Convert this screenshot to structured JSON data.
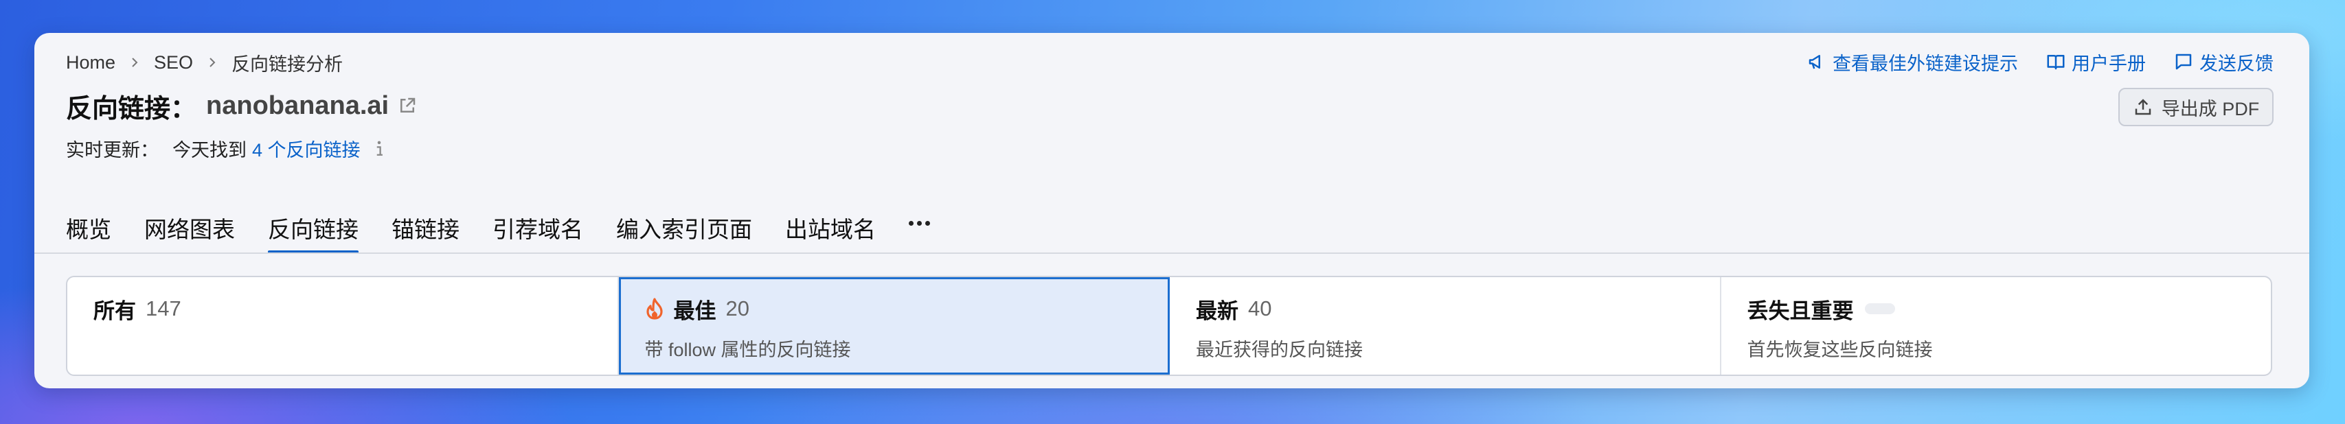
{
  "breadcrumb": {
    "home": "Home",
    "seo": "SEO",
    "current": "反向链接分析"
  },
  "title": {
    "prefix": "反向链接：",
    "domain": "nanobanana.ai"
  },
  "live": {
    "label": "实时更新：",
    "found_prefix": "今天找到",
    "link_text": "4 个反向链接"
  },
  "actions": {
    "tips": "查看最佳外链建设提示",
    "manual": "用户手册",
    "feedback": "发送反馈",
    "export": "导出成 PDF"
  },
  "tabs": [
    {
      "label": "概览"
    },
    {
      "label": "网络图表"
    },
    {
      "label": "反向链接",
      "active": true
    },
    {
      "label": "锚链接"
    },
    {
      "label": "引荐域名"
    },
    {
      "label": "编入索引页面"
    },
    {
      "label": "出站域名"
    }
  ],
  "filters": [
    {
      "name": "所有",
      "count": "147",
      "sub": ""
    },
    {
      "name": "最佳",
      "count": "20",
      "sub": "带 follow 属性的反向链接",
      "active": true,
      "icon": "fire-icon"
    },
    {
      "name": "最新",
      "count": "40",
      "sub": "最近获得的反向链接"
    },
    {
      "name": "丢失且重要",
      "count": "",
      "sub": "首先恢复这些反向链接"
    }
  ],
  "colors": {
    "accent": "#0a62c9",
    "fire": "#f0642c",
    "active_bg": "#e2ebfa"
  }
}
